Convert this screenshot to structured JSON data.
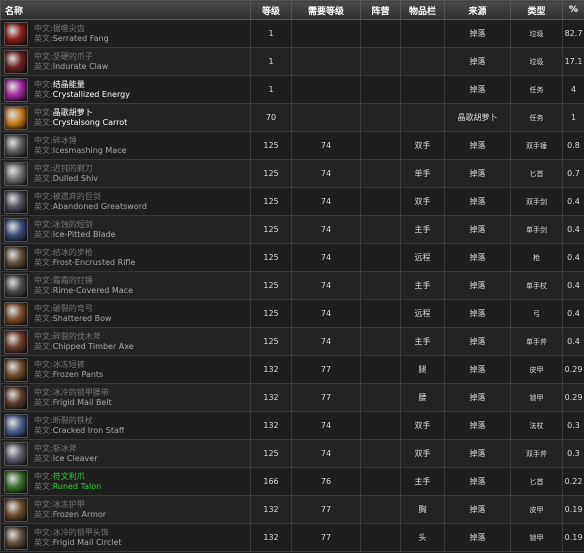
{
  "headers": {
    "name": "名称",
    "level": "等级",
    "req": "需要等级",
    "faction": "阵营",
    "slot": "物品栏",
    "source": "来源",
    "type": "类型",
    "pct": "%"
  },
  "labels": {
    "cn": "中文:",
    "en": "英文:"
  },
  "rows": [
    {
      "cn": "锯噬尖齿",
      "en": "Serrated Fang",
      "level": "1",
      "req": "",
      "faction": "",
      "slot": "",
      "source": "掉落",
      "type": "垃圾",
      "pct": "82.7",
      "quality": "gray",
      "icon": "fang-icon",
      "color": "#8a1b1b"
    },
    {
      "cn": "坚硬的爪子",
      "en": "Indurate Claw",
      "level": "1",
      "req": "",
      "faction": "",
      "slot": "",
      "source": "掉落",
      "type": "垃圾",
      "pct": "17.1",
      "quality": "gray",
      "icon": "claw-icon",
      "color": "#6b1f1f"
    },
    {
      "cn": "结晶能量",
      "en": "Crystallized Energy",
      "level": "1",
      "req": "",
      "faction": "",
      "slot": "",
      "source": "掉落",
      "type": "任务",
      "pct": "4",
      "quality": "white",
      "icon": "crystal-energy-icon",
      "color": "#a0249a"
    },
    {
      "cn": "晶歌胡萝卜",
      "en": "Crystalsong Carrot",
      "level": "70",
      "req": "",
      "faction": "",
      "slot": "",
      "source": "晶歌胡萝卜",
      "type": "任务",
      "pct": "1",
      "quality": "white",
      "icon": "carrot-icon",
      "color": "#c67a1a"
    },
    {
      "cn": "碎冰锤",
      "en": "Icesmashing Mace",
      "level": "125",
      "req": "74",
      "faction": "",
      "slot": "双手",
      "source": "掉落",
      "type": "双手锤",
      "pct": "0.8",
      "quality": "gray",
      "icon": "mace-icon",
      "color": "#5a5a5a"
    },
    {
      "cn": "迟钝的剃刀",
      "en": "Dulled Shiv",
      "level": "125",
      "req": "74",
      "faction": "",
      "slot": "单手",
      "source": "掉落",
      "type": "匕首",
      "pct": "0.7",
      "quality": "gray",
      "icon": "dagger-icon",
      "color": "#6f6f6f"
    },
    {
      "cn": "被遗弃的巨剑",
      "en": "Abandoned Greatsword",
      "level": "125",
      "req": "74",
      "faction": "",
      "slot": "双手",
      "source": "掉落",
      "type": "双手剑",
      "pct": "0.4",
      "quality": "gray",
      "icon": "greatsword-icon",
      "color": "#4b4b5a"
    },
    {
      "cn": "冰蚀的短剑",
      "en": "Ice-Pitted Blade",
      "level": "125",
      "req": "74",
      "faction": "",
      "slot": "主手",
      "source": "掉落",
      "type": "单手剑",
      "pct": "0.4",
      "quality": "gray",
      "icon": "blade-icon",
      "color": "#3a4a7a"
    },
    {
      "cn": "结冰的步枪",
      "en": "Frost-Encrusted Rifle",
      "level": "125",
      "req": "74",
      "faction": "",
      "slot": "远程",
      "source": "掉落",
      "type": "枪",
      "pct": "0.4",
      "quality": "gray",
      "icon": "rifle-icon",
      "color": "#5a4a3a"
    },
    {
      "cn": "霜霜的钉锤",
      "en": "Rime-Covered Mace",
      "level": "125",
      "req": "74",
      "faction": "",
      "slot": "主手",
      "source": "掉落",
      "type": "单手杖",
      "pct": "0.4",
      "quality": "gray",
      "icon": "spiked-mace-icon",
      "color": "#4a4a4a"
    },
    {
      "cn": "破裂的弯弓",
      "en": "Shattered Bow",
      "level": "125",
      "req": "74",
      "faction": "",
      "slot": "远程",
      "source": "掉落",
      "type": "弓",
      "pct": "0.4",
      "quality": "gray",
      "icon": "bow-icon",
      "color": "#7a4a2a"
    },
    {
      "cn": "碎裂的伐木斧",
      "en": "Chipped Timber Axe",
      "level": "125",
      "req": "74",
      "faction": "",
      "slot": "主手",
      "source": "掉落",
      "type": "单手斧",
      "pct": "0.4",
      "quality": "gray",
      "icon": "axe-icon",
      "color": "#6a3a2a"
    },
    {
      "cn": "冰冻短裤",
      "en": "Frozen Pants",
      "level": "132",
      "req": "77",
      "faction": "",
      "slot": "腿",
      "source": "掉落",
      "type": "皮甲",
      "pct": "0.29",
      "quality": "gray",
      "icon": "pants-icon",
      "color": "#6a4a2a"
    },
    {
      "cn": "冰冷的锁甲腰带",
      "en": "Frigid Mail Belt",
      "level": "132",
      "req": "77",
      "faction": "",
      "slot": "腰",
      "source": "掉落",
      "type": "锁甲",
      "pct": "0.29",
      "quality": "gray",
      "icon": "belt-icon",
      "color": "#5a3a2a"
    },
    {
      "cn": "断裂的铁杖",
      "en": "Cracked Iron Staff",
      "level": "132",
      "req": "74",
      "faction": "",
      "slot": "双手",
      "source": "掉落",
      "type": "法杖",
      "pct": "0.3",
      "quality": "gray",
      "icon": "staff-icon",
      "color": "#4a5a8a"
    },
    {
      "cn": "斩冰斧",
      "en": "Ice Cleaver",
      "level": "125",
      "req": "74",
      "faction": "",
      "slot": "双手",
      "source": "掉落",
      "type": "双手斧",
      "pct": "0.3",
      "quality": "gray",
      "icon": "cleaver-icon",
      "color": "#5a5a6a"
    },
    {
      "cn": "符文利爪",
      "en": "Runed Talon",
      "level": "166",
      "req": "76",
      "faction": "",
      "slot": "主手",
      "source": "掉落",
      "type": "匕首",
      "pct": "0.22",
      "quality": "green",
      "icon": "talon-icon",
      "color": "#3a6a2a"
    },
    {
      "cn": "冰冻护甲",
      "en": "Frozen Armor",
      "level": "132",
      "req": "77",
      "faction": "",
      "slot": "胸",
      "source": "掉落",
      "type": "皮甲",
      "pct": "0.19",
      "quality": "gray",
      "icon": "chest-armor-icon",
      "color": "#6a4a2a"
    },
    {
      "cn": "冰冷的锁甲头饰",
      "en": "Frigid Mail Circlet",
      "level": "132",
      "req": "77",
      "faction": "",
      "slot": "头",
      "source": "掉落",
      "type": "锁甲",
      "pct": "0.19",
      "quality": "gray",
      "icon": "helm-icon",
      "color": "#5a4a3a"
    }
  ]
}
